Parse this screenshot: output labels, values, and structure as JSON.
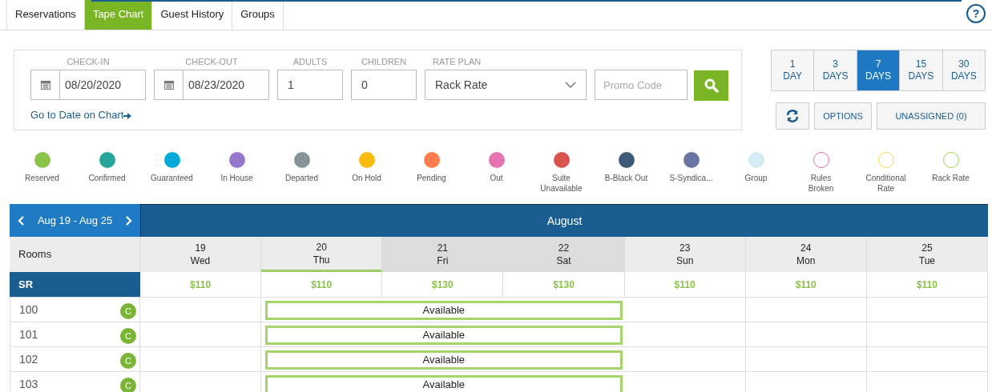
{
  "tabs": [
    {
      "label": "Reservations",
      "selected": false
    },
    {
      "label": "Tape Chart",
      "selected": true
    },
    {
      "label": "Guest History",
      "selected": false
    },
    {
      "label": "Groups",
      "selected": false
    }
  ],
  "help": {
    "label": "?"
  },
  "search": {
    "check_in": {
      "label": "CHECK-IN",
      "value": "08/20/2020"
    },
    "check_out": {
      "label": "CHECK-OUT",
      "value": "08/23/2020"
    },
    "adults": {
      "label": "ADULTS",
      "value": "1"
    },
    "children": {
      "label": "CHILDREN",
      "value": "0"
    },
    "rate_plan": {
      "label": "RATE PLAN",
      "value": "Rack Rate"
    },
    "promo": {
      "placeholder": "Promo Code"
    },
    "go_to_date": "Go to Date on Chart"
  },
  "ranges": [
    {
      "number": "1",
      "unit": "DAY",
      "selected": false
    },
    {
      "number": "3",
      "unit": "DAYS",
      "selected": false
    },
    {
      "number": "7",
      "unit": "DAYS",
      "selected": true
    },
    {
      "number": "15",
      "unit": "DAYS",
      "selected": false
    },
    {
      "number": "30",
      "unit": "DAYS",
      "selected": false
    }
  ],
  "actions": {
    "options": "OPTIONS",
    "unassigned": "UNASSIGNED (0)"
  },
  "legend": [
    {
      "label": "Reserved",
      "color": "#8bc34a",
      "kind": "filled"
    },
    {
      "label": "Confirmed",
      "color": "#26a69a",
      "kind": "filled"
    },
    {
      "label": "Guaranteed",
      "color": "#03a9d8",
      "kind": "filled"
    },
    {
      "label": "In House",
      "color": "#9575cd",
      "kind": "filled"
    },
    {
      "label": "Departed",
      "color": "#85939a",
      "kind": "filled"
    },
    {
      "label": "On Hold",
      "color": "#f9bb0c",
      "kind": "filled"
    },
    {
      "label": "Pending",
      "color": "#ff7d4e",
      "kind": "filled"
    },
    {
      "label": "Out",
      "color": "#e573b0",
      "kind": "filled"
    },
    {
      "label": "Suite\nUnavailable",
      "color": "#d9534f",
      "kind": "filled"
    },
    {
      "label": "B-Black Out",
      "color": "#3d5a77",
      "kind": "filled"
    },
    {
      "label": "S-Syndica...",
      "color": "#6975a3",
      "kind": "filled"
    },
    {
      "label": "Group",
      "color": "#d3ecf4",
      "kind": "filled"
    },
    {
      "label": "Rules\nBroken",
      "color": "#d86fa8",
      "kind": "ring"
    },
    {
      "label": "Conditional\nRate",
      "color": "#fbd43f",
      "kind": "ring"
    },
    {
      "label": "Rack Rate",
      "color": "#a5d24a",
      "kind": "ring"
    }
  ],
  "chart": {
    "range": "Aug 19 - Aug 25",
    "month": "August",
    "rooms_header": "Rooms",
    "days": [
      {
        "date": "19",
        "weekday": "Wed",
        "selected": false,
        "weekend": false
      },
      {
        "date": "20",
        "weekday": "Thu",
        "selected": true,
        "weekend": false
      },
      {
        "date": "21",
        "weekday": "Fri",
        "selected": false,
        "weekend": true
      },
      {
        "date": "22",
        "weekday": "Sat",
        "selected": false,
        "weekend": true
      },
      {
        "date": "23",
        "weekday": "Sun",
        "selected": false,
        "weekend": false
      },
      {
        "date": "24",
        "weekday": "Mon",
        "selected": false,
        "weekend": false
      },
      {
        "date": "25",
        "weekday": "Tue",
        "selected": false,
        "weekend": false
      }
    ],
    "room_type": {
      "name": "SR",
      "rates": [
        "$110",
        "$110",
        "$130",
        "$130",
        "$110",
        "$110",
        "$110"
      ]
    },
    "rooms": [
      {
        "number": "100",
        "badge": "C",
        "block": "Available",
        "booked": [
          false,
          true,
          true,
          true,
          false,
          false,
          false
        ]
      },
      {
        "number": "101",
        "badge": "C",
        "block": "Available",
        "booked": [
          false,
          true,
          true,
          true,
          false,
          false,
          false
        ]
      },
      {
        "number": "102",
        "badge": "C",
        "block": "Available",
        "booked": [
          false,
          true,
          true,
          true,
          false,
          false,
          false
        ]
      },
      {
        "number": "103",
        "badge": "C",
        "block": "Available",
        "booked": [
          false,
          true,
          true,
          true,
          false,
          false,
          false
        ]
      }
    ]
  }
}
